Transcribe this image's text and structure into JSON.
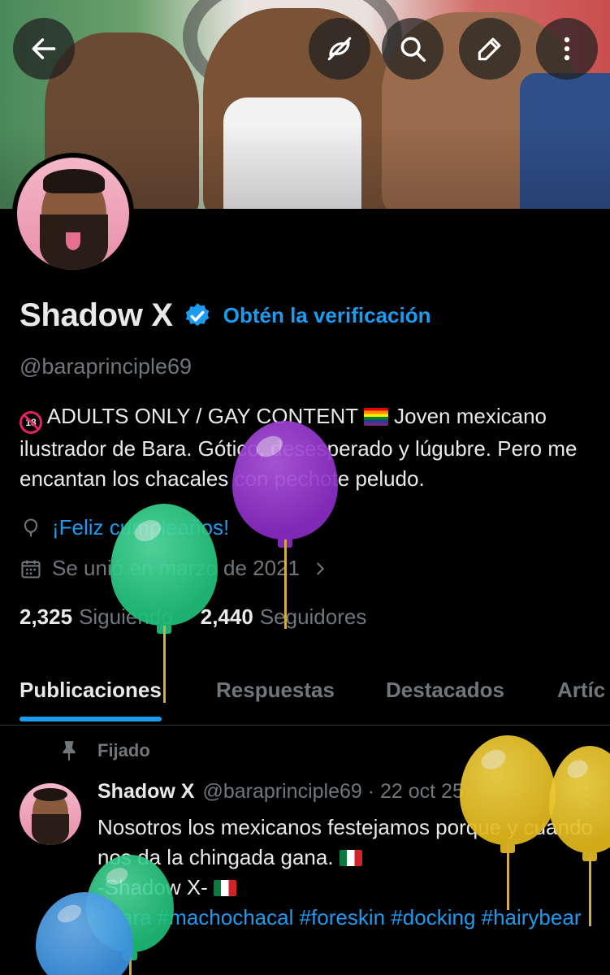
{
  "profile": {
    "name": "Shadow X",
    "get_verified_label": "Obtén la verificación",
    "handle": "@baraprinciple69",
    "bio_part1": "ADULTS ONLY / GAY CONTENT",
    "bio_part2": "Joven mexicano ilustrador de Bara. Gótico, desesperado y lúgubre. Pero me encantan los chacales con pechote peludo.",
    "birthday": "¡Feliz cumpleaños!",
    "joined": "Se unió en marzo de 2021",
    "following_count": "2,325",
    "following_label": "Siguiendo",
    "followers_count": "2,440",
    "followers_label": "Seguidores"
  },
  "tabs": [
    {
      "label": "Publicaciones",
      "active": true
    },
    {
      "label": "Respuestas",
      "active": false
    },
    {
      "label": "Destacados",
      "active": false
    },
    {
      "label": "Artíc",
      "active": false
    }
  ],
  "pinned_post": {
    "pinned_label": "Fijado",
    "author": "Shadow X",
    "handle_date": "@baraprinciple69 · 22 oct 25",
    "line1": "Nosotros los mexicanos festejamos porque y cuando nos da la chingada gana.",
    "line2": "-Shadow X-",
    "tags": "#bara #machochacal #foreskin #docking #hairybear"
  },
  "icons": {
    "back": "back-arrow-icon",
    "no_repost": "repost-off-icon",
    "search": "search-icon",
    "edit": "edit-icon",
    "more": "more-vertical-icon"
  },
  "colors": {
    "accent": "#1d9bf0",
    "muted": "#71767b",
    "text": "#e7e9ea",
    "background": "#000000"
  }
}
